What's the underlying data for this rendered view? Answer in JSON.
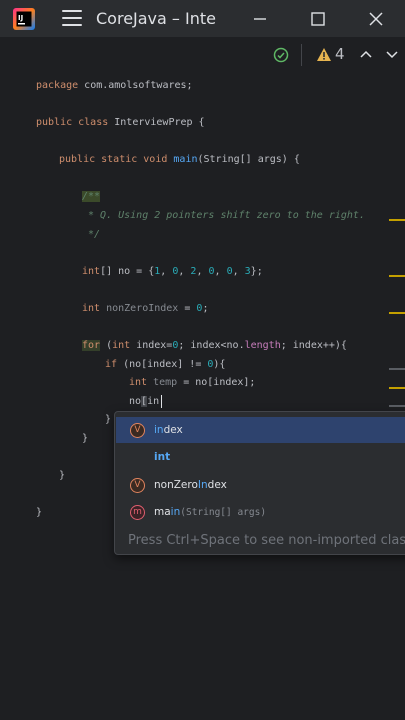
{
  "window": {
    "title": "CoreJava – Inte",
    "app_icon": "intellij-idea-icon"
  },
  "toolbar": {
    "inspection_ok_icon": "check-icon",
    "warning_icon": "warning-icon",
    "warning_count": "4",
    "nav_up_icon": "chevron-up-icon",
    "nav_down_icon": "chevron-down-icon"
  },
  "code": {
    "l1_kw": "package",
    "l1_pkg": " com.amolsoftwares;",
    "l2_kw": "public class",
    "l2_name": " InterviewPrep {",
    "l3_kw": "public static void",
    "l3_fn": "main",
    "l3_rest": "(String[] args) {",
    "c1": "/**",
    "c2": " * Q. Using 2 pointers shift zero to the right.",
    "c3": " */",
    "l4_type": "int[] no = {",
    "l4_n1": "1",
    "l4_s1": ", ",
    "l4_n2": "0",
    "l4_s2": ", ",
    "l4_n3": "2",
    "l4_s3": ", ",
    "l4_n4": "0",
    "l4_s4": ", ",
    "l4_n5": "0",
    "l4_s5": ", ",
    "l4_n6": "3",
    "l4_end": "};",
    "l5_kw": "int",
    "l5_var": " nonZeroIndex",
    "l5_eq": " = ",
    "l5_num": "0",
    "l5_end": ";",
    "l6_kw": "for",
    "l6_a": " (",
    "l6_int": "int",
    "l6_b": " index=",
    "l6_n0": "0",
    "l6_c": "; index<no.",
    "l6_len": "length",
    "l6_d": "; index++){",
    "l7_kw": "if",
    "l7_a": " (no[index] != ",
    "l7_n": "0",
    "l7_b": "){",
    "l8_kw": "int",
    "l8_var": " temp",
    "l8_rest": " = no[index];",
    "l9_a": "no",
    "l9_br": "[",
    "l9_b": "in",
    "l10": "}",
    "l11": "}",
    "l12": "}",
    "l13": "}"
  },
  "completion": {
    "items": [
      {
        "badge": "V",
        "match": "in",
        "rest": "dex",
        "sig": ""
      },
      {
        "badge": "",
        "match": "int",
        "rest": "",
        "sig": ""
      },
      {
        "badge": "V",
        "pre": "nonZero",
        "match": "In",
        "rest": "dex",
        "sig": ""
      },
      {
        "badge": "m",
        "pre": "ma",
        "match": "in",
        "rest": "",
        "sig": "(String[] args)"
      }
    ],
    "hint": "Press Ctrl+Space to see non-imported clas"
  }
}
